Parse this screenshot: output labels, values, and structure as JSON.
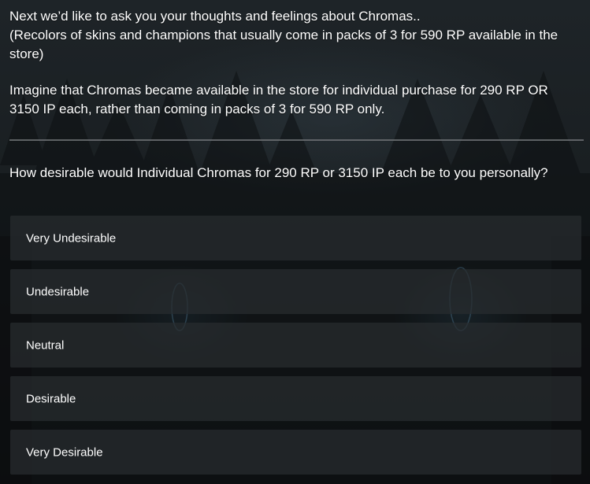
{
  "survey": {
    "intro_line1": "Next we’d like to ask you your thoughts and feelings about Chromas..",
    "intro_line2": "(Recolors of skins and champions that usually come in packs of 3 for 590 RP available in the store)",
    "intro_para2": "Imagine that Chromas became available in the store for individual purchase for 290 RP OR 3150 IP each, rather than coming in packs of 3 for 590 RP only.",
    "question": "How desirable would Individual Chromas for 290 RP or 3150 IP each be to you personally?",
    "options": [
      {
        "label": "Very Undesirable"
      },
      {
        "label": "Undesirable"
      },
      {
        "label": "Neutral"
      },
      {
        "label": "Desirable"
      },
      {
        "label": "Very Desirable"
      }
    ]
  },
  "colors": {
    "background": "#15191b",
    "option_bg": "#282c2f",
    "divider": "#6b6f72",
    "text": "#ffffff"
  }
}
